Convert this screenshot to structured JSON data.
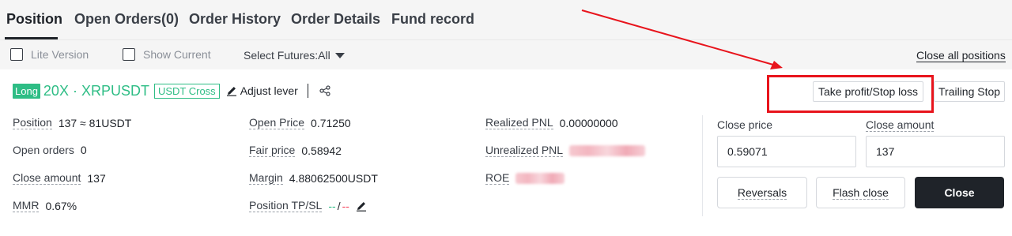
{
  "tabs": [
    {
      "label": "Position",
      "active": true
    },
    {
      "label": "Open Orders(0)",
      "active": false
    },
    {
      "label": "Order History",
      "active": false
    },
    {
      "label": "Order Details",
      "active": false
    },
    {
      "label": "Fund record",
      "active": false
    }
  ],
  "filters": {
    "lite_version": {
      "label": "Lite Version",
      "checked": false
    },
    "show_current": {
      "label": "Show Current",
      "checked": false
    },
    "select_futures": "Select Futures:All",
    "close_all": "Close all positions"
  },
  "position_header": {
    "side": "Long",
    "leverage_symbol": "20X · XRPUSDT",
    "margin_mode": "USDT Cross",
    "adjust_lever": "Adjust lever"
  },
  "actions": {
    "take_profit_stop_loss": "Take profit/Stop loss",
    "trailing_stop": "Trailing Stop"
  },
  "details": {
    "position": {
      "label": "Position",
      "value": "137 ≈ 81USDT"
    },
    "open_orders": {
      "label": "Open orders",
      "value": "0"
    },
    "close_amount": {
      "label": "Close amount",
      "value": "137"
    },
    "mmr": {
      "label": "MMR",
      "value": "0.67%"
    },
    "open_price": {
      "label": "Open Price",
      "value": "0.71250"
    },
    "fair_price": {
      "label": "Fair price",
      "value": "0.58942"
    },
    "margin": {
      "label": "Margin",
      "value": "4.88062500USDT"
    },
    "position_tpsl": {
      "label": "Position TP/SL",
      "tp": "--",
      "sep": "/",
      "sl": "--"
    },
    "realized_pnl": {
      "label": "Realized PNL",
      "value": "0.00000000"
    },
    "unrealized_pnl": {
      "label": "Unrealized PNL"
    },
    "roe": {
      "label": "ROE"
    }
  },
  "close_panel": {
    "close_price_label": "Close price",
    "close_price_value": "0.59071",
    "close_amount_label": "Close amount",
    "close_amount_value": "137",
    "reversals": "Reversals",
    "flash_close": "Flash close",
    "close": "Close"
  },
  "colors": {
    "long_green": "#2ebd85",
    "loss_red": "#f6465d",
    "annotation_red": "#e8141c",
    "dark_button": "#1f2329"
  }
}
